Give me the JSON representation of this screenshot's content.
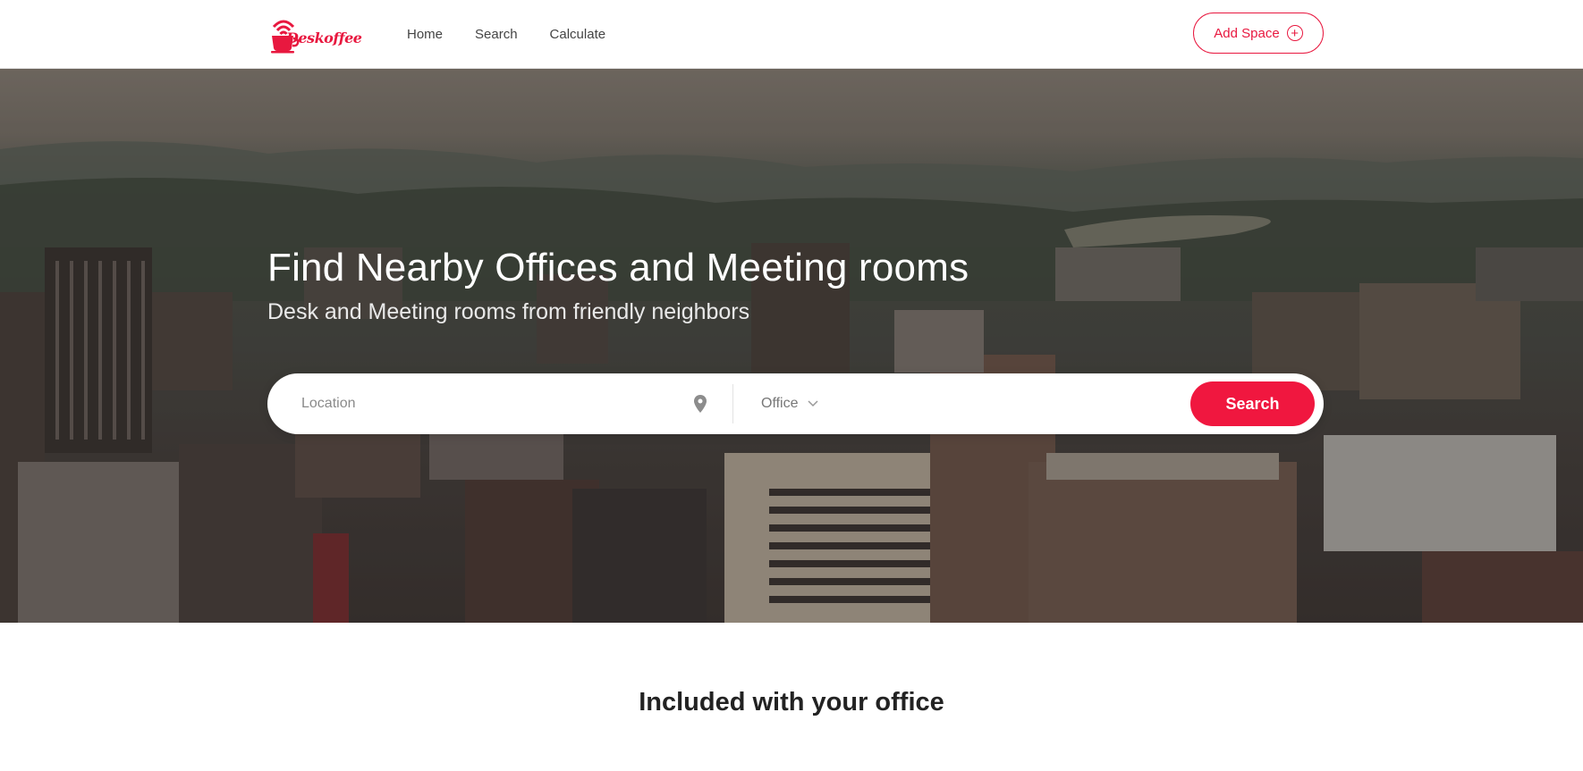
{
  "header": {
    "logo_text": "Deskoffee",
    "nav": [
      "Home",
      "Search",
      "Calculate"
    ],
    "add_space_label": "Add Space",
    "accent_color": "#e8183f"
  },
  "hero": {
    "title": "Find Nearby Offices and Meeting rooms",
    "subtitle": "Desk and Meeting rooms from friendly neighbors",
    "search": {
      "location_placeholder": "Location",
      "type_selected": "Office",
      "button_label": "Search"
    }
  },
  "section": {
    "title": "Included with your office"
  }
}
